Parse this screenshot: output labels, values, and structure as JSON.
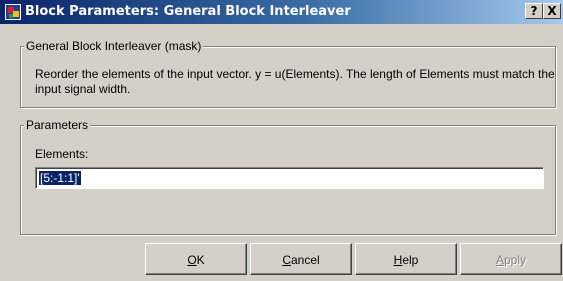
{
  "window": {
    "title": "Block Parameters: General Block Interleaver",
    "help_glyph": "?",
    "close_glyph": "X"
  },
  "mask_group": {
    "legend": "General Block Interleaver (mask)",
    "description": "Reorder the elements of the input vector. y = u(Elements). The length of Elements must match the input signal width."
  },
  "params_group": {
    "legend": "Parameters",
    "elements_label": "Elements:",
    "elements_value": "[5:-1:1]'"
  },
  "buttons": {
    "ok": {
      "mnemonic": "O",
      "rest": "K"
    },
    "cancel": {
      "mnemonic": "C",
      "rest": "ancel"
    },
    "help": {
      "mnemonic": "H",
      "rest": "elp"
    },
    "apply": {
      "mnemonic": "A",
      "rest": "pply",
      "disabled": true
    }
  },
  "icons": {
    "title_icon": "simulink-block-icon"
  }
}
